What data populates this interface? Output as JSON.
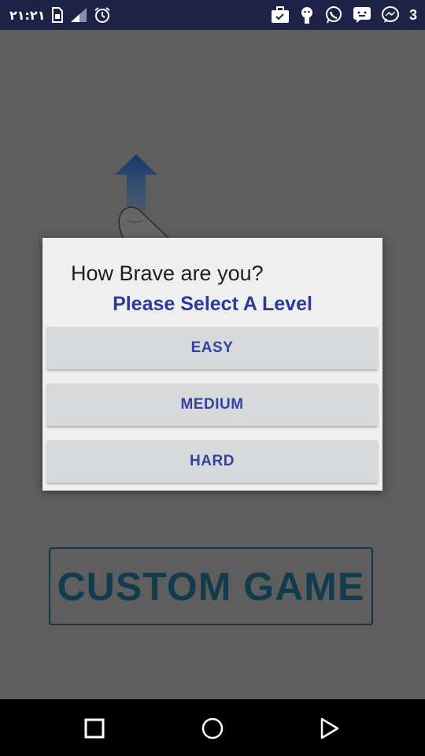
{
  "status_bar": {
    "time": "٢١:٢١",
    "notification_count": "3",
    "icons": [
      "sim-icon",
      "signal-icon",
      "alarm-icon",
      "briefcase-icon",
      "android-icon",
      "whatsapp-icon",
      "chat-icon",
      "messenger-icon"
    ]
  },
  "background": {
    "custom_game_label": "CUSTOM GAME",
    "swipe_icon": "swipe-up-hand-icon"
  },
  "dialog": {
    "title": "How Brave are you?",
    "subtitle": "Please Select A Level",
    "levels": [
      "EASY",
      "MEDIUM",
      "HARD"
    ]
  },
  "nav_bar": {
    "icons": [
      "recents-icon",
      "home-icon",
      "back-icon"
    ]
  },
  "colors": {
    "status_bar_bg": "#1d2346",
    "scrim_bg": "#5e5e5e",
    "dialog_bg": "#efefef",
    "button_bg": "#d8d9da",
    "accent_text": "#2c3a9a",
    "custom_game_text": "#123b4d"
  }
}
